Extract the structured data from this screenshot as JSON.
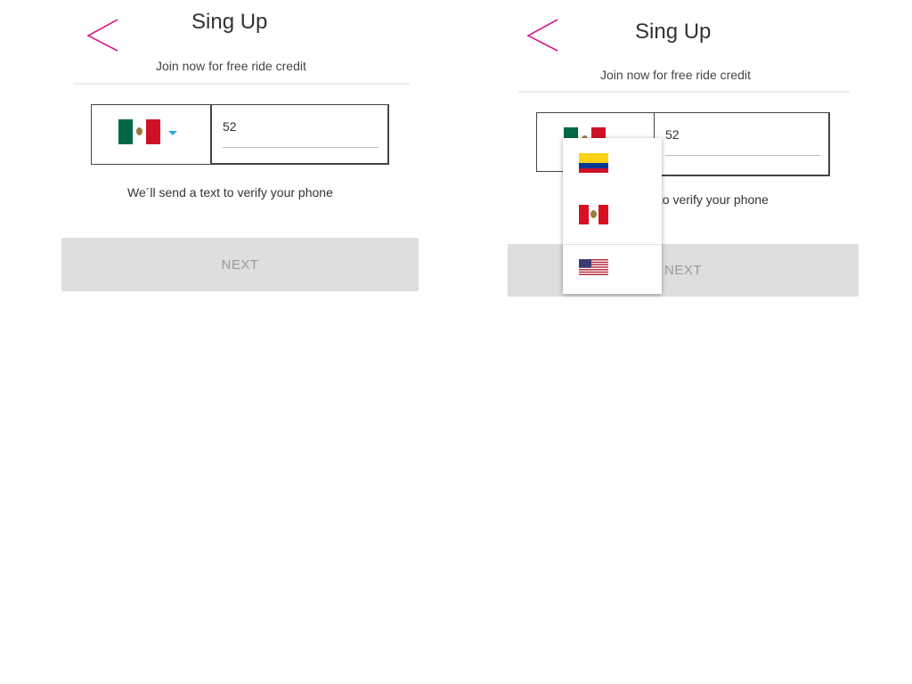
{
  "colors": {
    "accent": "#d81b8a",
    "caret": "#29a6df",
    "next_bg": "#dedede",
    "next_text": "#999999"
  },
  "screen_left": {
    "back_icon": "chevron-left-icon",
    "title": "Sing Up",
    "subtitle": "Join now for free ride credit",
    "country": {
      "flag": "mexico-flag-icon"
    },
    "phone": {
      "value": "52"
    },
    "info": "We´ll send a text to verify your phone",
    "next_label": "NEXT"
  },
  "screen_right": {
    "back_icon": "chevron-left-icon",
    "title": "Sing Up",
    "subtitle": "Join now for free ride credit",
    "country": {
      "flag": "mexico-flag-icon"
    },
    "phone": {
      "value": "52"
    },
    "info": "We´ll send a text to verify your phone",
    "next_label": "NEXT",
    "dropdown": {
      "options": [
        "colombia-flag-icon",
        "peru-flag-icon",
        "usa-flag-icon"
      ]
    }
  }
}
